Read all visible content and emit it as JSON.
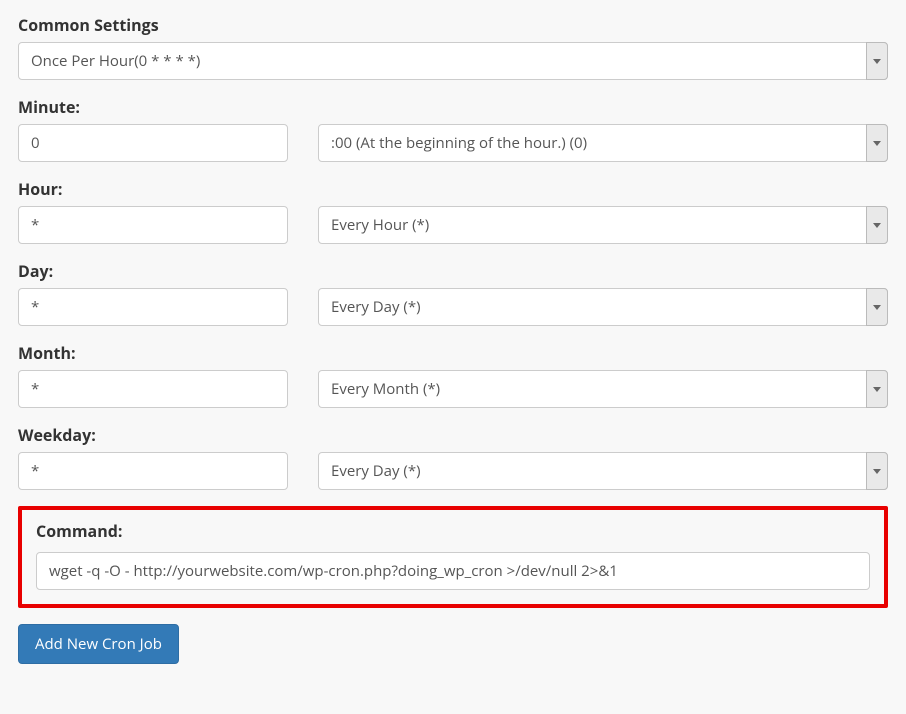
{
  "commonSettings": {
    "label": "Common Settings",
    "selected": "Once Per Hour(0 * * * *)"
  },
  "minute": {
    "label": "Minute:",
    "value": "0",
    "selected": ":00 (At the beginning of the hour.) (0)"
  },
  "hour": {
    "label": "Hour:",
    "value": "*",
    "selected": "Every Hour (*)"
  },
  "day": {
    "label": "Day:",
    "value": "*",
    "selected": "Every Day (*)"
  },
  "month": {
    "label": "Month:",
    "value": "*",
    "selected": "Every Month (*)"
  },
  "weekday": {
    "label": "Weekday:",
    "value": "*",
    "selected": "Every Day (*)"
  },
  "command": {
    "label": "Command:",
    "value": "wget -q -O - http://yourwebsite.com/wp-cron.php?doing_wp_cron >/dev/null 2>&1"
  },
  "submit": {
    "label": "Add New Cron Job"
  }
}
